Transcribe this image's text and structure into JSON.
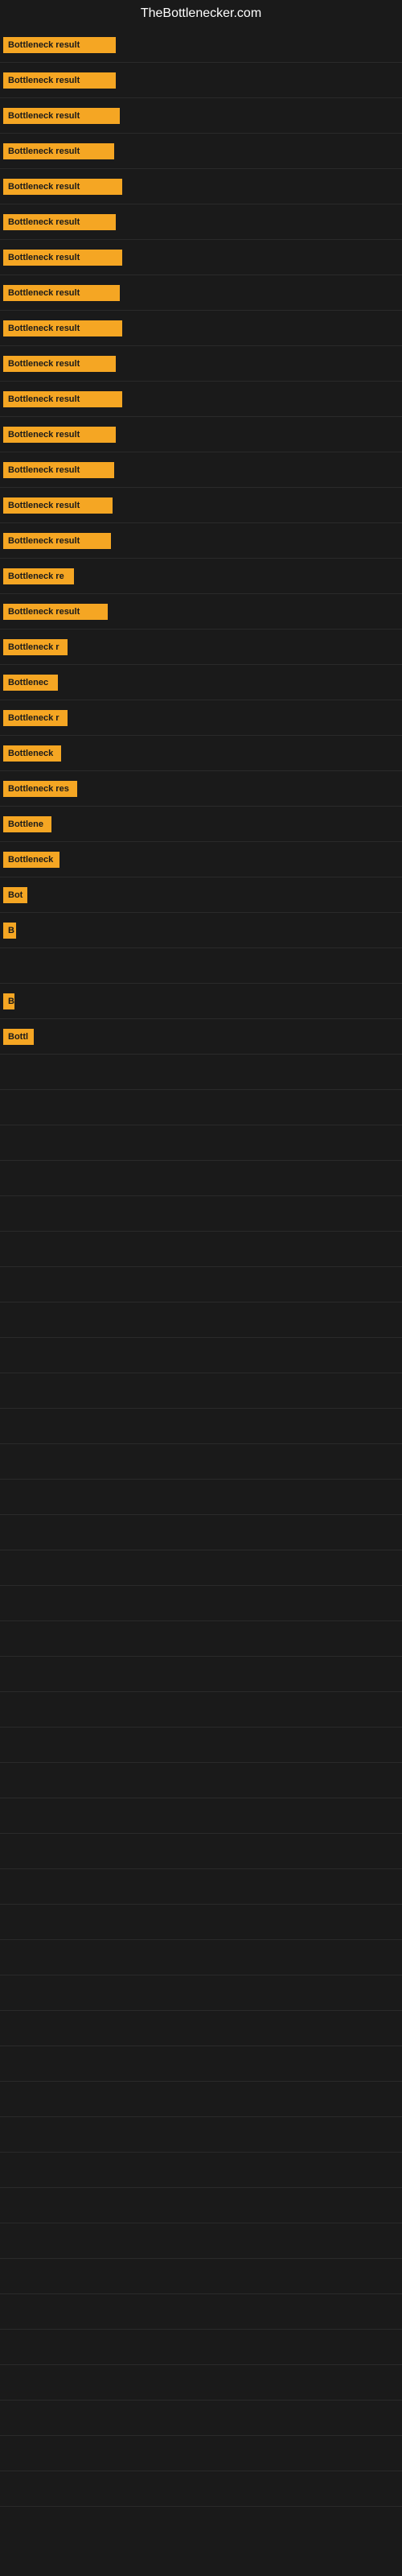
{
  "site": {
    "title": "TheBottlenecker.com"
  },
  "rows": [
    {
      "label": "Bottleneck result",
      "badge_width": 140
    },
    {
      "label": "Bottleneck result",
      "badge_width": 140
    },
    {
      "label": "Bottleneck result",
      "badge_width": 145
    },
    {
      "label": "Bottleneck result",
      "badge_width": 138
    },
    {
      "label": "Bottleneck result",
      "badge_width": 148
    },
    {
      "label": "Bottleneck result",
      "badge_width": 140
    },
    {
      "label": "Bottleneck result",
      "badge_width": 148
    },
    {
      "label": "Bottleneck result",
      "badge_width": 145
    },
    {
      "label": "Bottleneck result",
      "badge_width": 148
    },
    {
      "label": "Bottleneck result",
      "badge_width": 140
    },
    {
      "label": "Bottleneck result",
      "badge_width": 148
    },
    {
      "label": "Bottleneck result",
      "badge_width": 140
    },
    {
      "label": "Bottleneck result",
      "badge_width": 138
    },
    {
      "label": "Bottleneck result",
      "badge_width": 136
    },
    {
      "label": "Bottleneck result",
      "badge_width": 134
    },
    {
      "label": "Bottleneck re",
      "badge_width": 88
    },
    {
      "label": "Bottleneck result",
      "badge_width": 130
    },
    {
      "label": "Bottleneck r",
      "badge_width": 80
    },
    {
      "label": "Bottlenec",
      "badge_width": 68
    },
    {
      "label": "Bottleneck r",
      "badge_width": 80
    },
    {
      "label": "Bottleneck",
      "badge_width": 72
    },
    {
      "label": "Bottleneck res",
      "badge_width": 92
    },
    {
      "label": "Bottlene",
      "badge_width": 60
    },
    {
      "label": "Bottleneck",
      "badge_width": 70
    },
    {
      "label": "Bot",
      "badge_width": 30
    },
    {
      "label": "B",
      "badge_width": 16
    },
    {
      "label": "",
      "badge_width": 0
    },
    {
      "label": "B",
      "badge_width": 14
    },
    {
      "label": "Bottl",
      "badge_width": 38
    },
    {
      "label": "",
      "badge_width": 4
    }
  ]
}
